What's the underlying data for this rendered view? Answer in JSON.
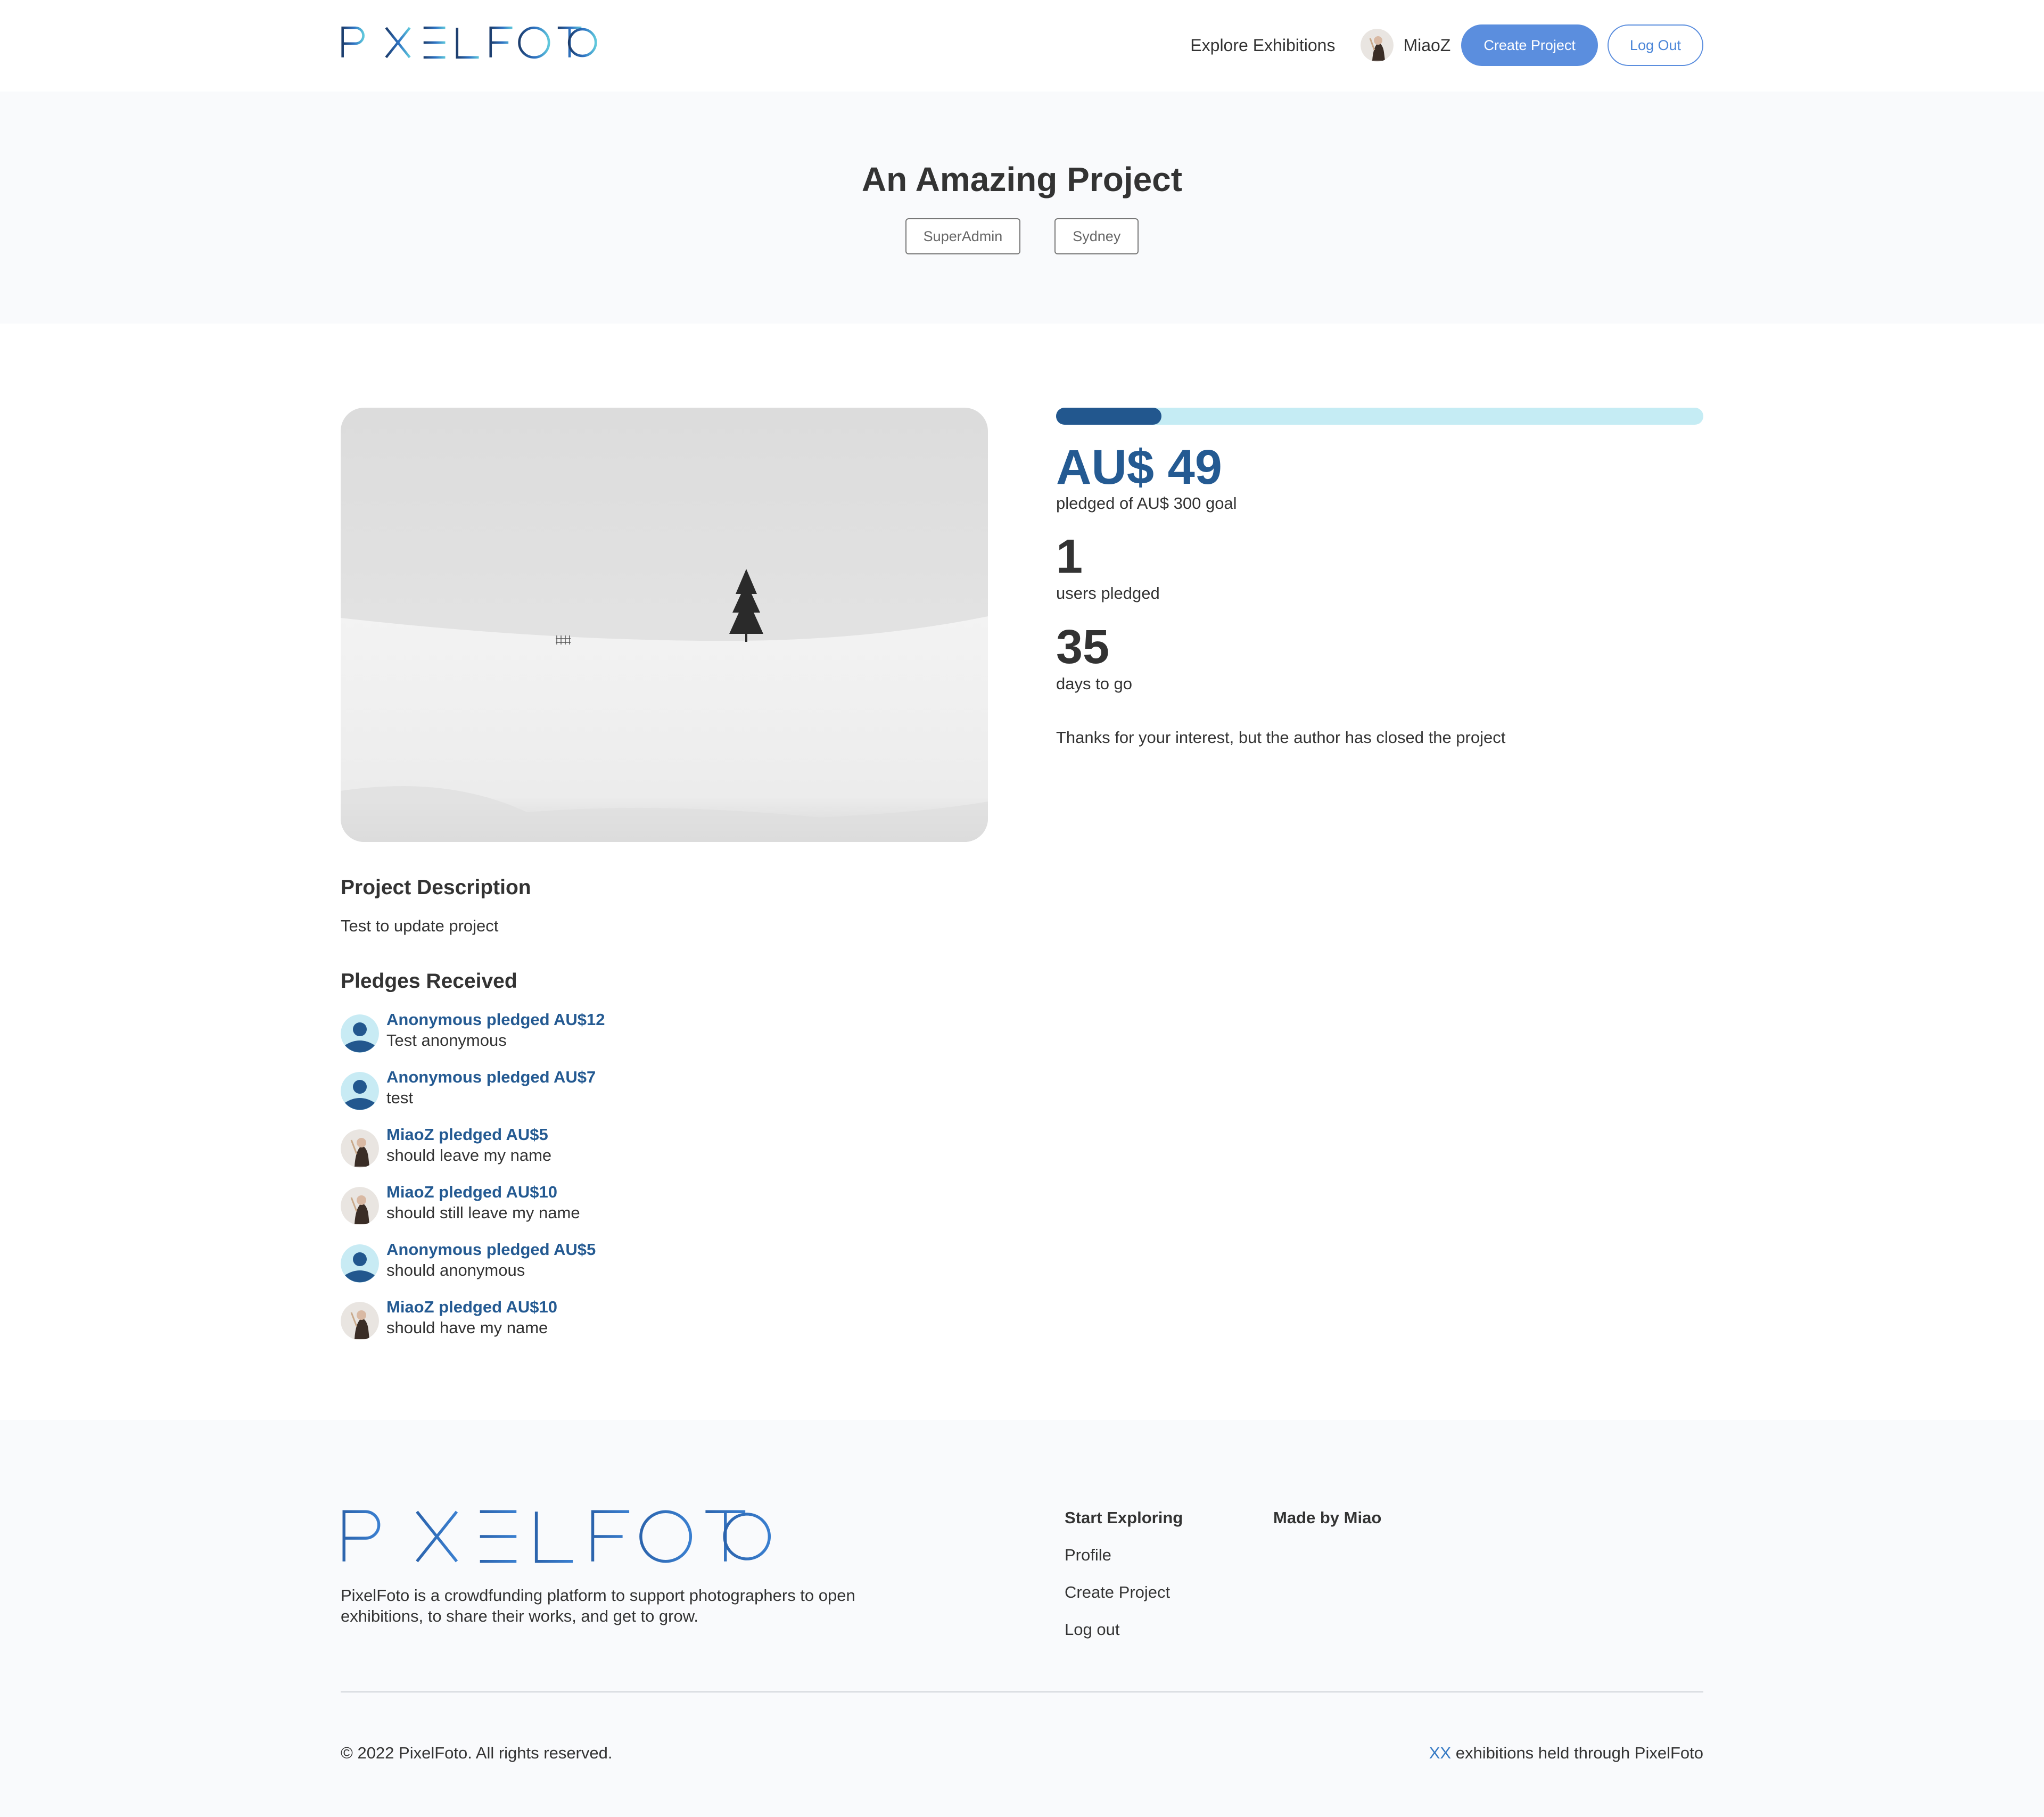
{
  "header": {
    "logo_text": "PIXELFOTO",
    "nav_explore": "Explore Exhibitions",
    "username": "MiaoZ",
    "create_label": "Create Project",
    "logout_label": "Log Out"
  },
  "hero": {
    "title": "An Amazing Project",
    "tags": [
      "SuperAdmin",
      "Sydney"
    ]
  },
  "funding": {
    "progress_fraction": 0.163,
    "amount": "AU$ 49",
    "amount_caption": "pledged of AU$ 300 goal",
    "backers": "1",
    "backers_caption": "users pledged",
    "days": "35",
    "days_caption": "days to go",
    "status_text": "Thanks for your interest, but the author has closed the project"
  },
  "description": {
    "heading": "Project Description",
    "text": "Test to update project"
  },
  "pledges": {
    "heading": "Pledges Received",
    "items": [
      {
        "title": "Anonymous pledged AU$12",
        "message": "Test anonymous",
        "avatar": "anonymous-avatar-icon"
      },
      {
        "title": "Anonymous pledged AU$7",
        "message": "test",
        "avatar": "anonymous-avatar-icon"
      },
      {
        "title": "MiaoZ pledged AU$5",
        "message": "should leave my name",
        "avatar": "user-photo-avatar"
      },
      {
        "title": "MiaoZ pledged AU$10",
        "message": "should still leave my name",
        "avatar": "user-photo-avatar"
      },
      {
        "title": "Anonymous pledged AU$5",
        "message": "should anonymous",
        "avatar": "anonymous-avatar-icon"
      },
      {
        "title": "MiaoZ pledged AU$10",
        "message": "should have my name",
        "avatar": "user-photo-avatar"
      }
    ]
  },
  "footer": {
    "logo_text": "PIXELFOTO",
    "about": "PixelFoto is a crowdfunding platform to support photographers to open exhibitions, to share their works, and get to grow.",
    "col1_heading": "Start Exploring",
    "col1_links": [
      "Profile",
      "Create Project",
      "Log out"
    ],
    "col2_heading": "Made by Miao",
    "copyright": "© 2022 PixelFoto. All rights reserved.",
    "stat_count": "XX",
    "stat_text": " exhibitions held through PixelFoto"
  },
  "colors": {
    "brand_blue": "#245a92",
    "button_blue": "#5b8ede",
    "progress_track": "#c5ecf4",
    "progress_fill": "#22578e"
  }
}
